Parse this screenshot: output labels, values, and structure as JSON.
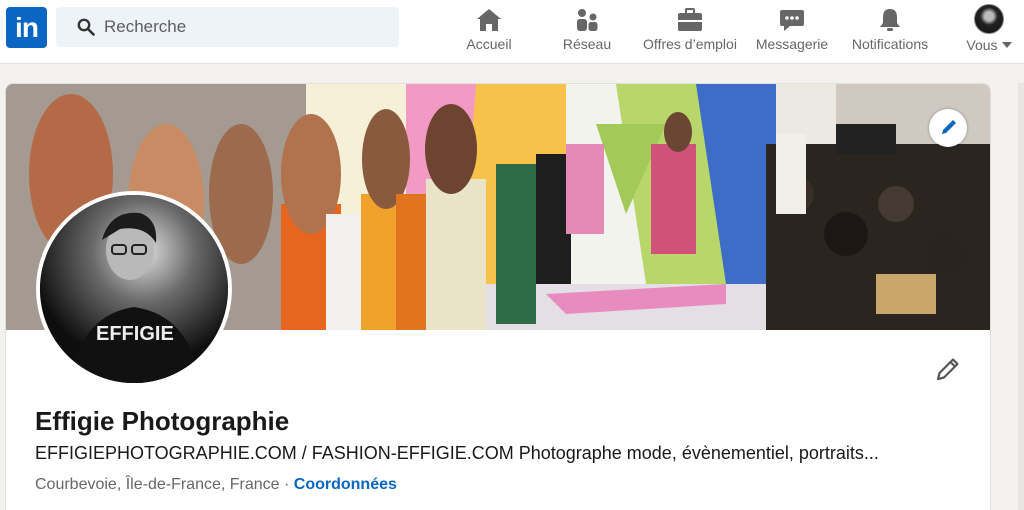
{
  "logo": {
    "text": "in"
  },
  "search": {
    "placeholder": "Recherche"
  },
  "nav": {
    "home": "Accueil",
    "network": "Réseau",
    "jobs": "Offres d’emploi",
    "messaging": "Messagerie",
    "notifications": "Notifications",
    "me": "Vous"
  },
  "profile": {
    "name": "Effigie Photographie",
    "headline": "EFFIGIEPHOTOGRAPHIE.COM / FASHION-EFFIGIE.COM Photographe mode, évènementiel, portraits...",
    "location": "Courbevoie, Île-de-France, France",
    "separator": " · ",
    "contact_link": "Coordonnées",
    "photo_print": "EFFIGIE"
  },
  "colors": {
    "brand": "#0a66c2",
    "nav_text": "#666666",
    "search_bg": "#edf3f8"
  }
}
